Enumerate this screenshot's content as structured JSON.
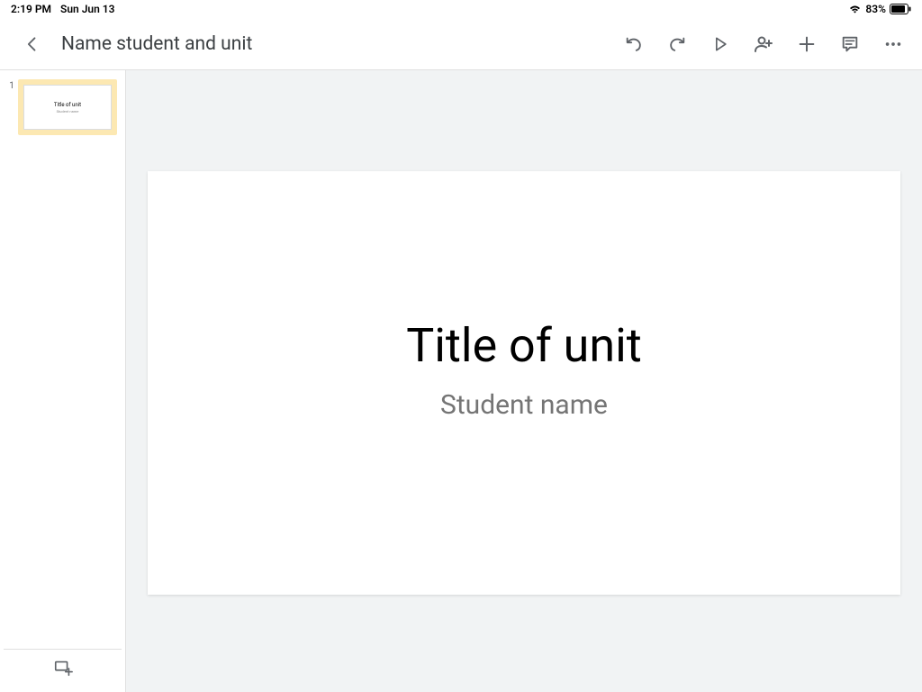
{
  "status": {
    "time": "2:19 PM",
    "date": "Sun Jun 13",
    "battery": "83%"
  },
  "toolbar": {
    "title": "Name student and unit"
  },
  "sidebar": {
    "slides": [
      {
        "number": "1",
        "title": "Title of unit",
        "subtitle": "Student name"
      }
    ]
  },
  "canvas": {
    "title": "Title of unit",
    "subtitle": "Student name"
  }
}
